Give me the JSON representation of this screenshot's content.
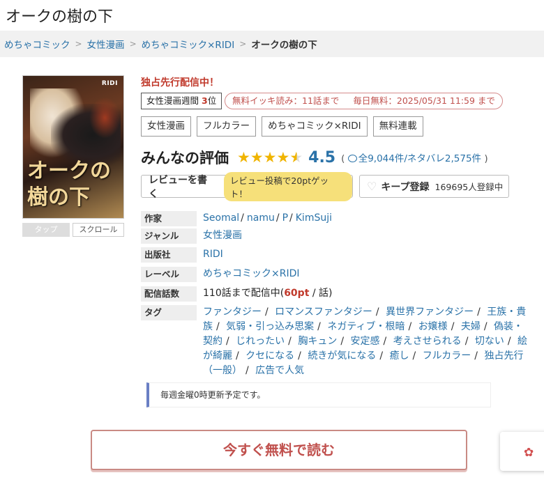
{
  "page_title": "オークの樹の下",
  "breadcrumb": {
    "items": [
      "めちゃコミック",
      "女性漫画",
      "めちゃコミック×RIDI"
    ],
    "current": "オークの樹の下",
    "separator": ">"
  },
  "cover": {
    "publisher_mark": "RIDI",
    "title_line1": "オークの",
    "title_line2": "樹の下"
  },
  "cover_buttons": {
    "tap": "タップ",
    "scroll": "スクロール"
  },
  "exclusive_label": "独占先行配信中！",
  "rank_badge": {
    "label": "女性漫画週間",
    "rank": "3",
    "suffix": "位"
  },
  "free_badge": {
    "text1": "無料イッキ読み：11話まで",
    "text2": "毎日無料：2025/05/31 11:59 まで"
  },
  "category_tags": [
    "女性漫画",
    "フルカラー",
    "めちゃコミック×RIDI",
    "無料連載"
  ],
  "rating": {
    "label": "みんなの評価",
    "stars": 4.5,
    "score": "4.5",
    "open_paren": "(",
    "comment_count": "全9,044件",
    "spoiler_count": "/ネタバレ2,575件",
    "close_paren": ")"
  },
  "review_button": {
    "label": "レビューを書く",
    "pill": "レビュー投稿で20ptゲット！"
  },
  "keep_button": {
    "label": "キープ登録",
    "count": "169695人登録中"
  },
  "info": {
    "author_key": "作家",
    "authors": [
      "Seomal",
      "namu",
      "P",
      "KimSuji"
    ],
    "genre_key": "ジャンル",
    "genre": "女性漫画",
    "publisher_key": "出版社",
    "publisher": "RIDI",
    "label_key": "レーベル",
    "label": "めちゃコミック×RIDI",
    "episodes_key": "配信話数",
    "episodes_prefix": "110話まで配信中(",
    "episodes_pt": "60pt",
    "episodes_suffix": " / 話)",
    "tags_key": "タグ",
    "tags": [
      "ファンタジー",
      "ロマンスファンタジー",
      "異世界ファンタジー",
      "王族・貴族",
      "気弱・引っ込み思案",
      "ネガティブ・根暗",
      "お嬢様",
      "夫婦",
      "偽装・契約",
      "じれったい",
      "胸キュン",
      "安定感",
      "考えさせられる",
      "切ない",
      "絵が綺麗",
      "クセになる",
      "続きが気になる",
      "癒し",
      "フルカラー",
      "独占先行（一般）",
      "広告で人気"
    ]
  },
  "notice": "毎週金曜0時更新予定です。",
  "read_button": "今すぐ無料で読む",
  "colors": {
    "link": "#2a72a8",
    "accent_red": "#c0392b",
    "star": "#f0b400",
    "notice_bar": "#6a7fc4"
  }
}
